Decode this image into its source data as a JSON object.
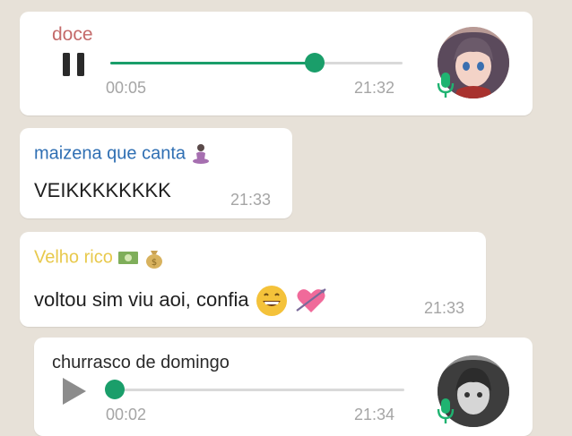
{
  "messages": [
    {
      "type": "voice",
      "sender": "doce",
      "duration": "00:05",
      "time": "21:32",
      "progress": 0.7,
      "state": "playing",
      "control_icon": "pause-icon",
      "avatar_icon": "anime-avatar-icon"
    },
    {
      "type": "text",
      "sender": "maizena que canta",
      "sender_emoji_icon": "meditating-person-icon",
      "text": "VEIKKKKKKKK",
      "time": "21:33"
    },
    {
      "type": "text",
      "sender": "Velho rico",
      "sender_emoji_icons": [
        "money-bills-icon",
        "money-bag-icon"
      ],
      "text": "voltou sim viu aoi, confia",
      "text_emoji_icons": [
        "grinning-face-icon",
        "heart-arrow-icon"
      ],
      "time": "21:33"
    },
    {
      "type": "voice",
      "sender": "churrasco de domingo",
      "duration": "00:02",
      "time": "21:34",
      "progress": 0.0,
      "state": "paused",
      "control_icon": "play-icon",
      "avatar_icon": "grayscale-avatar-icon"
    }
  ],
  "colors": {
    "background": "#e7e1d8",
    "bubble": "#ffffff",
    "accent_green": "#1a9e6a",
    "sender_doce": "#c46a6a",
    "sender_maizena": "#2f6fb3",
    "sender_velho": "#e8c94c",
    "timestamp": "#a5a5a5"
  }
}
